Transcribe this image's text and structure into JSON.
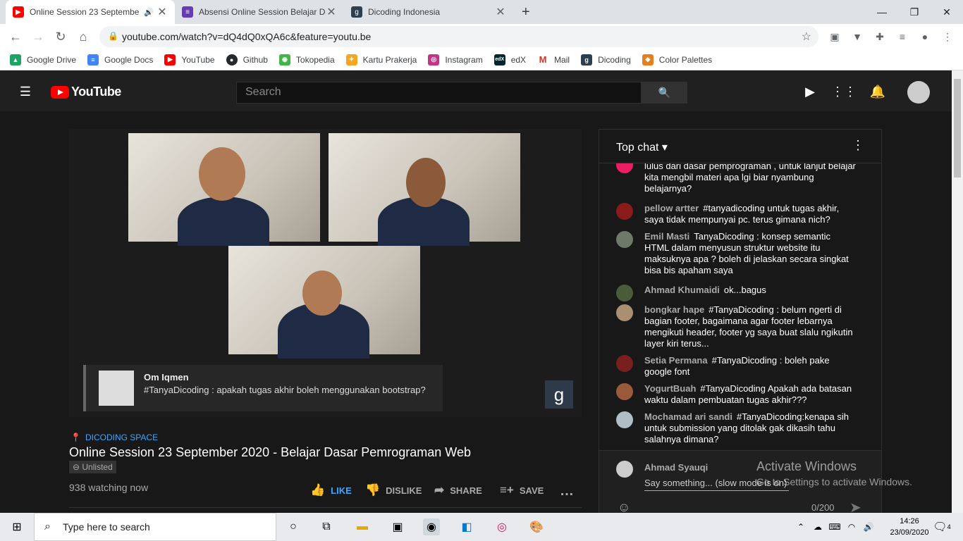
{
  "browser": {
    "tabs": [
      {
        "title": "Online Session 23 Septembe",
        "active": true
      },
      {
        "title": "Absensi Online Session Belajar Da",
        "active": false
      },
      {
        "title": "Dicoding Indonesia",
        "active": false
      }
    ],
    "url": "youtube.com/watch?v=dQ4dQ0xQA6c&feature=youtu.be",
    "bookmarks": [
      {
        "label": "Google Drive",
        "color": "#1fa463"
      },
      {
        "label": "Google Docs",
        "color": "#4285f4"
      },
      {
        "label": "YouTube",
        "color": "#ff0000"
      },
      {
        "label": "Github",
        "color": "#24292e"
      },
      {
        "label": "Tokopedia",
        "color": "#42b549"
      },
      {
        "label": "Kartu Prakerja",
        "color": "#f5a623"
      },
      {
        "label": "Instagram",
        "color": "#c13584"
      },
      {
        "label": "edX",
        "color": "#02262b"
      },
      {
        "label": "Mail",
        "color": "#d93025"
      },
      {
        "label": "Dicoding",
        "color": "#2d3e50"
      },
      {
        "label": "Color Palettes",
        "color": "#e67e22"
      }
    ]
  },
  "youtube": {
    "logo_text": "YouTube",
    "search_placeholder": "Search"
  },
  "video": {
    "overlay_name": "Om Iqmen",
    "overlay_message": "#TanyaDicoding : apakah tugas akhir boleh menggunakan bootstrap?",
    "watermark": "g",
    "channel": "DICODING SPACE",
    "title": "Online Session 23 September 2020 - Belajar Dasar Pemrograman Web",
    "badge": "Unlisted",
    "watching": "938 watching now",
    "actions": {
      "like": "LIKE",
      "dislike": "DISLIKE",
      "share": "SHARE",
      "save": "SAVE"
    }
  },
  "chat": {
    "header": "Top chat",
    "messages": [
      {
        "author": "",
        "text": "lulus dari dasar pemprograman , untuk lanjut belajar kita mengbil materi apa lgi biar nyambung belajarnya?",
        "avatar_color": "#e91e63"
      },
      {
        "author": "pellow artter",
        "text": "#tanyadicoding untuk tugas akhir, saya tidak mempunyai pc. terus gimana nich?",
        "avatar_color": "#8b1a1a"
      },
      {
        "author": "Emil Masti",
        "text": "TanyaDicoding : konsep semantic HTML dalam menyusun struktur website itu maksuknya apa ? boleh di jelaskan secara singkat bisa bis apaham saya",
        "avatar_color": "#6d7a6a"
      },
      {
        "author": "Ahmad Khumaidi",
        "text": "ok...bagus",
        "avatar_color": "#4a5a3a"
      },
      {
        "author": "bongkar hape",
        "text": "#TanyaDicoding : belum ngerti di bagian footer, bagaimana agar footer lebarnya mengikuti header, footer yg saya buat slalu ngikutin layer kiri terus...",
        "avatar_color": "#a89070"
      },
      {
        "author": "Setia Permana",
        "text": "#TanyaDicoding : boleh pake google font",
        "avatar_color": "#7a1f1f"
      },
      {
        "author": "YogurtBuah",
        "text": "#TanyaDicoding Apakah ada batasan waktu dalam pembuatan tugas akhir???",
        "avatar_color": "#9a5a3a"
      },
      {
        "author": "Mochamad ari sandi",
        "text": "#TanyaDicoding:kenapa sih untuk submission yang ditolak gak dikasih tahu salahnya dimana?",
        "avatar_color": "#b0bec5"
      }
    ],
    "input_user": "Ahmad Syauqi",
    "input_placeholder": "Say something... (slow mode is on)",
    "counter": "0/200"
  },
  "windows": {
    "activate_title": "Activate Windows",
    "activate_sub": "Go to Settings to activate Windows.",
    "search_placeholder": "Type here to search",
    "time": "14:26",
    "date": "23/09/2020",
    "notification_count": "4"
  }
}
